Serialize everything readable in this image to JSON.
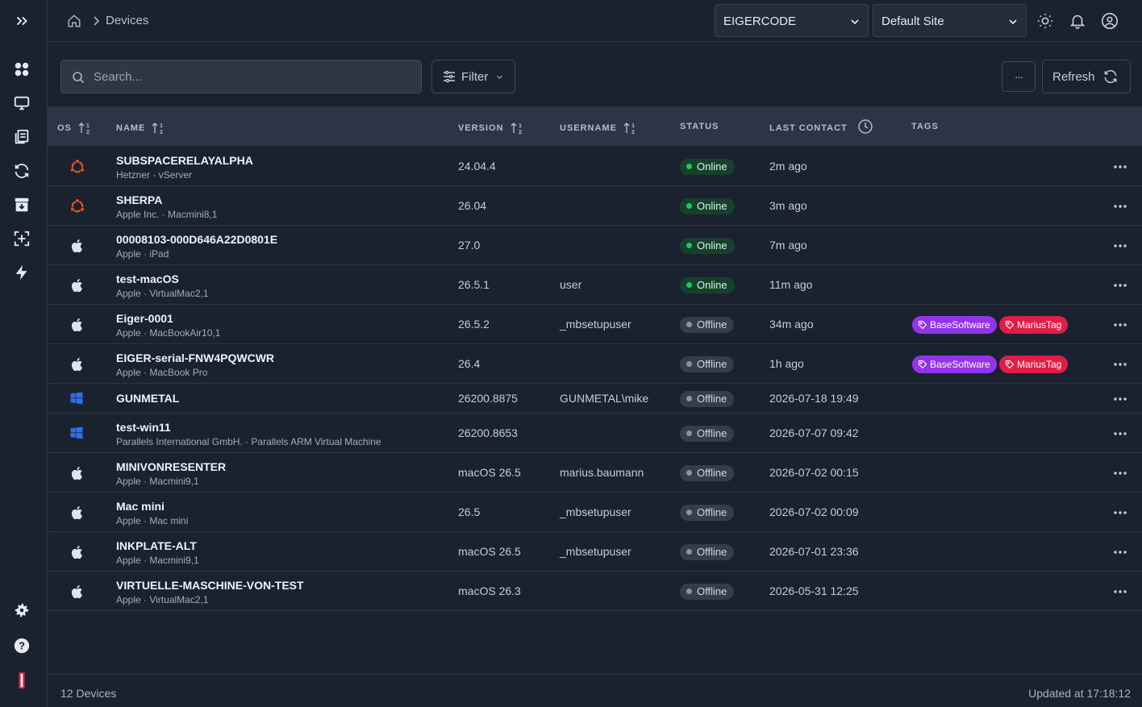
{
  "breadcrumb": {
    "current": "Devices"
  },
  "header": {
    "org_select": "EIGERCODE",
    "site_select": "Default Site"
  },
  "toolbar": {
    "search_placeholder": "Search...",
    "filter_label": "Filter",
    "more_label": "···",
    "refresh_label": "Refresh"
  },
  "table": {
    "columns": [
      "OS",
      "NAME",
      "VERSION",
      "USERNAME",
      "STATUS",
      "LAST CONTACT",
      "TAGS"
    ],
    "rows": [
      {
        "os": "ubuntu",
        "name": "SUBSPACERELAYALPHA",
        "sub": "Hetzner · vServer",
        "version": "24.04.4",
        "username": "",
        "status": "Online",
        "last": "2m ago",
        "tags": []
      },
      {
        "os": "ubuntu",
        "name": "SHERPA",
        "sub": "Apple Inc. · Macmini8,1",
        "version": "26.04",
        "username": "",
        "status": "Online",
        "last": "3m ago",
        "tags": []
      },
      {
        "os": "apple",
        "name": "00008103-000D646A22D0801E",
        "sub": "Apple · iPad",
        "version": "27.0",
        "username": "",
        "status": "Online",
        "last": "7m ago",
        "tags": []
      },
      {
        "os": "apple",
        "name": "test-macOS",
        "sub": "Apple · VirtualMac2,1",
        "version": "26.5.1",
        "username": "user",
        "status": "Online",
        "last": "11m ago",
        "tags": []
      },
      {
        "os": "apple",
        "name": "Eiger-0001",
        "sub": "Apple · MacBookAir10,1",
        "version": "26.5.2",
        "username": "_mbsetupuser",
        "status": "Offline",
        "last": "34m ago",
        "tags": [
          "BaseSoftware",
          "MariusTag"
        ]
      },
      {
        "os": "apple",
        "name": "EIGER-serial-FNW4PQWCWR",
        "sub": "Apple · MacBook Pro",
        "version": "26.4",
        "username": "",
        "status": "Offline",
        "last": "1h ago",
        "tags": [
          "BaseSoftware",
          "MariusTag"
        ]
      },
      {
        "os": "windows",
        "name": "GUNMETAL",
        "sub": "",
        "version": "26200.8875",
        "username": "GUNMETAL\\mike",
        "status": "Offline",
        "last": "2026-07-18 19:49",
        "tags": []
      },
      {
        "os": "windows",
        "name": "test-win11",
        "sub": "Parallels International GmbH. · Parallels ARM Virtual Machine",
        "version": "26200.8653",
        "username": "",
        "status": "Offline",
        "last": "2026-07-07 09:42",
        "tags": []
      },
      {
        "os": "apple",
        "name": "MINIVONRESENTER",
        "sub": "Apple · Macmini9,1",
        "version": "macOS 26.5",
        "username": "marius.baumann",
        "status": "Offline",
        "last": "2026-07-02 00:15",
        "tags": []
      },
      {
        "os": "apple",
        "name": "Mac mini",
        "sub": "Apple · Mac mini",
        "version": "26.5",
        "username": "_mbsetupuser",
        "status": "Offline",
        "last": "2026-07-02 00:09",
        "tags": []
      },
      {
        "os": "apple",
        "name": "INKPLATE-ALT",
        "sub": "Apple · Macmini9,1",
        "version": "macOS 26.5",
        "username": "_mbsetupuser",
        "status": "Offline",
        "last": "2026-07-01 23:36",
        "tags": []
      },
      {
        "os": "apple",
        "name": "VIRTUELLE-MASCHINE-VON-TEST",
        "sub": "Apple · VirtualMac2,1",
        "version": "macOS 26.3",
        "username": "",
        "status": "Offline",
        "last": "2026-05-31 12:25",
        "tags": []
      }
    ]
  },
  "footer": {
    "count": "12 Devices",
    "updated": "Updated at 17:18:12"
  },
  "colors": {
    "online": "#22c55e",
    "tag_basesoftware": "#9333ea",
    "tag_mariustag": "#e11d48",
    "ubuntu": "#e95420",
    "windows": "#2f6fe8"
  }
}
